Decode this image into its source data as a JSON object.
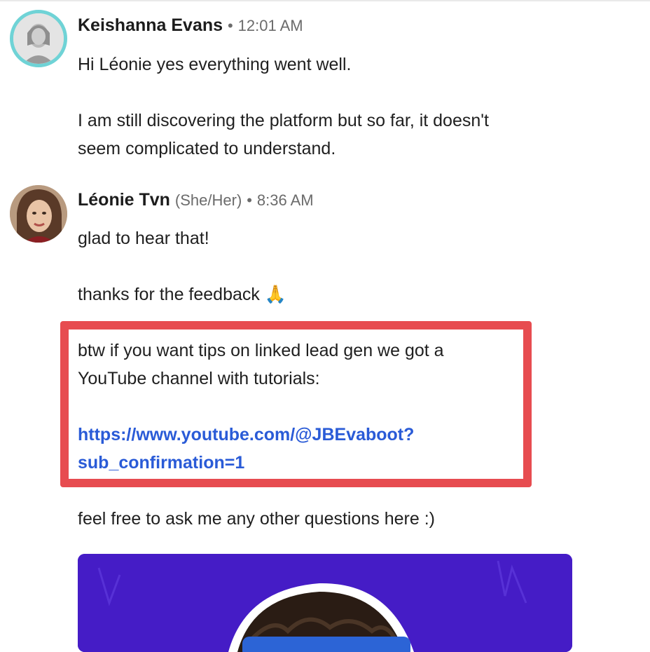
{
  "messages": [
    {
      "sender": "Keishanna Evans",
      "separator": "•",
      "time": "12:01 AM",
      "paragraphs": [
        "Hi Léonie yes everything went well.",
        "I am still discovering the platform but so far, it doesn't",
        "seem complicated to understand."
      ]
    },
    {
      "sender": "Léonie Tvn",
      "pronouns": "(She/Her)",
      "separator": "•",
      "time": "8:36 AM",
      "paragraphs": [
        "glad to hear that!",
        "thanks for the feedback 🙏",
        "btw if you want tips on linked lead gen we got a",
        "YouTube channel with tutorials:",
        "feel free to ask me any other questions here :)"
      ],
      "link": {
        "line1": "https://www.youtube.com/@JBEvaboot?",
        "line2": "sub_confirmation=1"
      }
    }
  ],
  "colors": {
    "avatar_ring": "#6fd3d6",
    "highlight_border": "#e74c50",
    "link": "#2a5bd7",
    "video_bg": "#4a1fd0"
  }
}
